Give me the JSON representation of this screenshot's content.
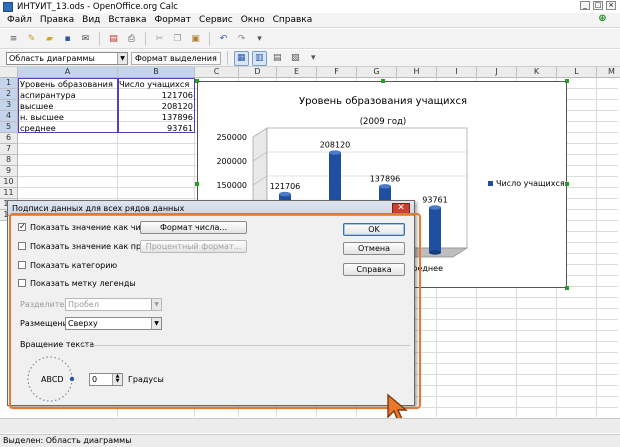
{
  "window": {
    "title": "ИНТУИТ_13.ods - OpenOffice.org Calc"
  },
  "menu": [
    "Файл",
    "Правка",
    "Вид",
    "Вставка",
    "Формат",
    "Сервис",
    "Окно",
    "Справка"
  ],
  "toolbar2": {
    "area_combo": "Область диаграммы",
    "selection_format": "Формат выделения"
  },
  "grid": {
    "columns": [
      "A",
      "B",
      "C",
      "D",
      "E",
      "F",
      "G",
      "H",
      "I",
      "J",
      "K",
      "L",
      "M"
    ],
    "rows": [
      "1",
      "2",
      "3",
      "4",
      "5",
      "6",
      "7",
      "8",
      "9",
      "10",
      "11",
      "12",
      "13"
    ],
    "cells": [
      [
        "Уровень образования",
        "Число учащихся"
      ],
      [
        "аспирантура",
        "121706"
      ],
      [
        "высшее",
        "208120"
      ],
      [
        "н. высшее",
        "137896"
      ],
      [
        "среднее",
        "93761"
      ]
    ]
  },
  "chart_data": {
    "type": "bar",
    "title": "Уровень образования учащихся",
    "subtitle": "(2009 год)",
    "categories": [
      "аспирантура",
      "высшее",
      "н. высшее",
      "среднее"
    ],
    "series": [
      {
        "name": "Число учащихся",
        "values": [
          121706,
          208120,
          137896,
          93761
        ]
      }
    ],
    "data_labels": [
      "121706",
      "208120",
      "137896",
      "93761"
    ],
    "y_ticks": [
      "250000",
      "200000",
      "150000"
    ],
    "ylim": [
      0,
      250000
    ],
    "visible_category_label": "среднее",
    "legend_position": "right",
    "colors": {
      "bar": "#1f4fa0"
    }
  },
  "dialog": {
    "title": "Подписи данных для всех рядов данных",
    "show_value_number": "Показать значение как число",
    "show_value_percent": "Показать значение как процент",
    "show_category": "Показать категорию",
    "show_legend_key": "Показать метку легенды",
    "number_format_btn": "Формат числа...",
    "percent_format_btn": "Процентный формат...",
    "separator_label": "Разделитель",
    "separator_value": "Пробел",
    "placement_label": "Размещение",
    "placement_value": "Сверху",
    "rotate_title": "Вращение текста",
    "abcd": "ABCD",
    "degrees_value": "0",
    "degrees_label": "Градусы",
    "ok": "OK",
    "cancel": "Отмена",
    "help": "Справка"
  },
  "status": {
    "text": "Выделен: Область диаграммы"
  }
}
